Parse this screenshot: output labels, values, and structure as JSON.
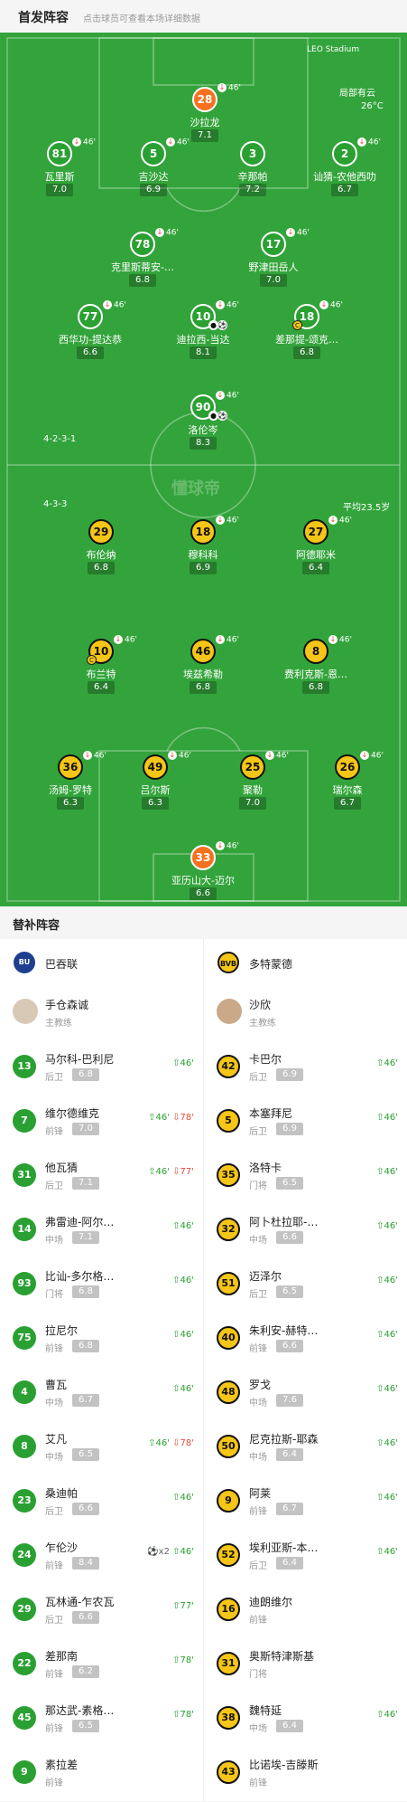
{
  "header": {
    "title": "首发阵容",
    "subtitle": "点击球员可查看本场详细数据"
  },
  "pitch": {
    "sponsor": "LEO Stadium",
    "weather": "局部有云",
    "temp": "26°C",
    "home_formation": "4-2-3-1",
    "away_formation": "4-3-3",
    "avg_age": "平均23.5岁",
    "watermark": "懂球帝"
  },
  "home_players": [
    {
      "num": "28",
      "name": "沙拉龙",
      "rating": "7.1",
      "sub": "46'",
      "gk": true
    },
    {
      "num": "81",
      "name": "瓦里斯",
      "rating": "7.0",
      "sub": "46'"
    },
    {
      "num": "5",
      "name": "吉沙达",
      "rating": "6.9",
      "sub": "46'"
    },
    {
      "num": "3",
      "name": "辛那帕",
      "rating": "7.2",
      "sub": ""
    },
    {
      "num": "2",
      "name": "讪猜-农他西叻",
      "rating": "6.7",
      "sub": "46'"
    },
    {
      "num": "78",
      "name": "克里斯蒂安-…",
      "rating": "6.8",
      "sub": "46'"
    },
    {
      "num": "17",
      "name": "野津田岳人",
      "rating": "7.0",
      "sub": "46'"
    },
    {
      "num": "77",
      "name": "西华功-提达恭",
      "rating": "6.6",
      "sub": "46'"
    },
    {
      "num": "10",
      "name": "迪拉西-当达",
      "rating": "8.1",
      "sub": "46'"
    },
    {
      "num": "18",
      "name": "差那提-颂克…",
      "rating": "6.8",
      "sub": "46'"
    },
    {
      "num": "90",
      "name": "洛伦岑",
      "rating": "8.3",
      "sub": "46'"
    }
  ],
  "away_players": [
    {
      "num": "29",
      "name": "布伦纳",
      "rating": "6.8",
      "sub": ""
    },
    {
      "num": "18",
      "name": "穆科科",
      "rating": "6.9",
      "sub": "46'"
    },
    {
      "num": "27",
      "name": "阿德耶米",
      "rating": "6.4",
      "sub": "46'"
    },
    {
      "num": "10",
      "name": "布兰特",
      "rating": "6.4",
      "sub": "46'"
    },
    {
      "num": "46",
      "name": "埃兹希勒",
      "rating": "6.8",
      "sub": "46'"
    },
    {
      "num": "8",
      "name": "费利克斯-恩…",
      "rating": "6.8",
      "sub": "46'"
    },
    {
      "num": "36",
      "name": "汤姆-罗特",
      "rating": "6.3",
      "sub": "46'"
    },
    {
      "num": "49",
      "name": "吕尔斯",
      "rating": "6.3",
      "sub": "46'"
    },
    {
      "num": "25",
      "name": "聚勒",
      "rating": "7.0",
      "sub": "46'"
    },
    {
      "num": "26",
      "name": "瑞尔森",
      "rating": "6.7",
      "sub": "46'"
    },
    {
      "num": "33",
      "name": "亚历山大-迈尔",
      "rating": "6.6",
      "sub": "46'",
      "gk": true
    }
  ],
  "bench": {
    "title": "替补阵容",
    "home_team": "巴吞联",
    "away_team": "多特蒙德",
    "home_badge": "BU",
    "away_badge": "BVB",
    "home_coach": {
      "name": "手仓森诚",
      "role": "主教练"
    },
    "away_coach": {
      "name": "沙欣",
      "role": "主教练"
    },
    "home": [
      {
        "num": "13",
        "name": "马尔科-巴利尼",
        "pos": "后卫",
        "rating": "6.8",
        "ev": [
          {
            "t": "in",
            "v": "46'"
          }
        ]
      },
      {
        "num": "7",
        "name": "维尔德维克",
        "pos": "前锋",
        "rating": "7.0",
        "ev": [
          {
            "t": "in",
            "v": "46'"
          },
          {
            "t": "out",
            "v": "78'"
          }
        ]
      },
      {
        "num": "31",
        "name": "他瓦猜",
        "pos": "后卫",
        "rating": "7.1",
        "ev": [
          {
            "t": "in",
            "v": "46'"
          },
          {
            "t": "out",
            "v": "77'"
          }
        ]
      },
      {
        "num": "14",
        "name": "弗雷迪-阿尔…",
        "pos": "中场",
        "rating": "7.1",
        "ev": [
          {
            "t": "in",
            "v": "46'"
          }
        ]
      },
      {
        "num": "93",
        "name": "比讪-多尔格…",
        "pos": "门将",
        "rating": "6.8",
        "ev": [
          {
            "t": "in",
            "v": "46'"
          }
        ]
      },
      {
        "num": "75",
        "name": "拉尼尔",
        "pos": "前锋",
        "rating": "6.8",
        "ev": [
          {
            "t": "in",
            "v": "46'"
          }
        ]
      },
      {
        "num": "4",
        "name": "曹瓦",
        "pos": "中场",
        "rating": "6.7",
        "ev": [
          {
            "t": "in",
            "v": "46'"
          }
        ]
      },
      {
        "num": "8",
        "name": "艾凡",
        "pos": "中场",
        "rating": "6.5",
        "ev": [
          {
            "t": "in",
            "v": "46'"
          },
          {
            "t": "out",
            "v": "78'"
          }
        ]
      },
      {
        "num": "23",
        "name": "桑迪帕",
        "pos": "后卫",
        "rating": "6.6",
        "ev": [
          {
            "t": "in",
            "v": "46'"
          }
        ]
      },
      {
        "num": "24",
        "name": "乍伦沙",
        "pos": "前锋",
        "rating": "8.4",
        "ev": [
          {
            "t": "goal",
            "v": "x2"
          },
          {
            "t": "in",
            "v": "46'"
          }
        ]
      },
      {
        "num": "29",
        "name": "瓦林通-乍农瓦",
        "pos": "后卫",
        "rating": "6.6",
        "ev": [
          {
            "t": "in",
            "v": "77'"
          }
        ]
      },
      {
        "num": "22",
        "name": "差那南",
        "pos": "前锋",
        "rating": "6.2",
        "ev": [
          {
            "t": "in",
            "v": "78'"
          }
        ]
      },
      {
        "num": "45",
        "name": "那达武-素格…",
        "pos": "前锋",
        "rating": "6.5",
        "ev": [
          {
            "t": "in",
            "v": "78'"
          }
        ]
      },
      {
        "num": "9",
        "name": "素拉差",
        "pos": "前锋",
        "rating": "",
        "ev": []
      }
    ],
    "away": [
      {
        "num": "42",
        "name": "卡巴尔",
        "pos": "后卫",
        "rating": "6.9",
        "ev": [
          {
            "t": "in",
            "v": "46'"
          }
        ]
      },
      {
        "num": "5",
        "name": "本塞拜尼",
        "pos": "后卫",
        "rating": "6.9",
        "ev": [
          {
            "t": "in",
            "v": "46'"
          }
        ]
      },
      {
        "num": "35",
        "name": "洛特卡",
        "pos": "门将",
        "rating": "6.5",
        "ev": [
          {
            "t": "in",
            "v": "46'"
          }
        ]
      },
      {
        "num": "32",
        "name": "阿卜杜拉耶-…",
        "pos": "中场",
        "rating": "6.6",
        "ev": [
          {
            "t": "in",
            "v": "46'"
          }
        ]
      },
      {
        "num": "51",
        "name": "迈泽尔",
        "pos": "后卫",
        "rating": "6.5",
        "ev": [
          {
            "t": "in",
            "v": "46'"
          }
        ]
      },
      {
        "num": "40",
        "name": "朱利安-赫特…",
        "pos": "前锋",
        "rating": "6.6",
        "ev": [
          {
            "t": "in",
            "v": "46'"
          }
        ]
      },
      {
        "num": "48",
        "name": "罗戈",
        "pos": "中场",
        "rating": "7.6",
        "ev": [
          {
            "t": "in",
            "v": "46'"
          }
        ]
      },
      {
        "num": "50",
        "name": "尼克拉斯-耶森",
        "pos": "中场",
        "rating": "6.4",
        "ev": [
          {
            "t": "in",
            "v": "46'"
          }
        ]
      },
      {
        "num": "9",
        "name": "阿莱",
        "pos": "前锋",
        "rating": "6.7",
        "ev": [
          {
            "t": "in",
            "v": "46'"
          }
        ]
      },
      {
        "num": "52",
        "name": "埃利亚斯-本…",
        "pos": "后卫",
        "rating": "6.4",
        "ev": [
          {
            "t": "in",
            "v": "46'"
          }
        ]
      },
      {
        "num": "16",
        "name": "迪朗维尔",
        "pos": "前锋",
        "rating": "",
        "ev": []
      },
      {
        "num": "31",
        "name": "奥斯特津斯基",
        "pos": "门将",
        "rating": "",
        "ev": []
      },
      {
        "num": "38",
        "name": "魏特延",
        "pos": "中场",
        "rating": "6.4",
        "ev": [
          {
            "t": "in",
            "v": "46'"
          }
        ]
      },
      {
        "num": "43",
        "name": "比诺埃-吉滕斯",
        "pos": "前锋",
        "rating": "",
        "ev": []
      }
    ]
  }
}
